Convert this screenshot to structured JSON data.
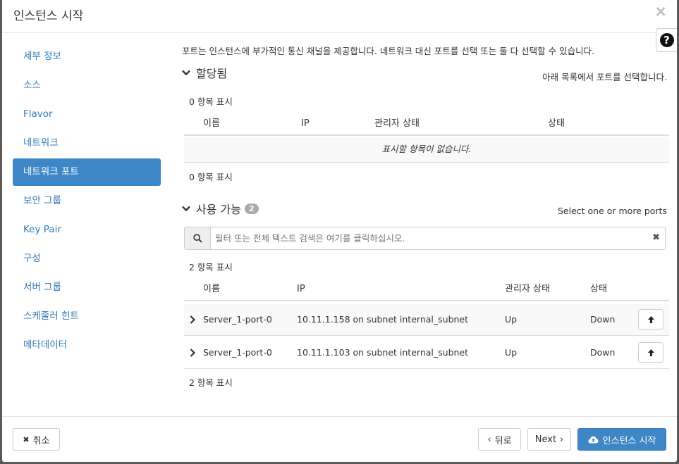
{
  "header": {
    "title": "인스턴스 시작",
    "close_label": "×",
    "help_label": "?"
  },
  "sidebar": {
    "items": [
      {
        "label": "세부 정보",
        "active": false
      },
      {
        "label": "소스",
        "active": false
      },
      {
        "label": "Flavor",
        "active": false
      },
      {
        "label": "네트워크",
        "active": false
      },
      {
        "label": "네트워크 포트",
        "active": true
      },
      {
        "label": "보안 그룹",
        "active": false
      },
      {
        "label": "Key Pair",
        "active": false
      },
      {
        "label": "구성",
        "active": false
      },
      {
        "label": "서버 그룹",
        "active": false
      },
      {
        "label": "스케줄러 힌트",
        "active": false
      },
      {
        "label": "메타데이터",
        "active": false
      }
    ]
  },
  "main": {
    "intro": "포트는 인스턴스에 부가적인 통신 채널을 제공합니다. 네트워크 대신 포트를 선택 또는 둘 다 선택할 수 있습니다.",
    "allocated": {
      "title": "할당됨",
      "help": "아래 목록에서 포트를 선택합니다.",
      "count_top": "0 항목 표시",
      "columns": [
        "이름",
        "IP",
        "관리자 상태",
        "상태"
      ],
      "empty": "표시할 항목이 없습니다.",
      "count_bottom": "0 항목 표시"
    },
    "available": {
      "title": "사용 가능",
      "badge": "2",
      "help": "Select one or more ports",
      "search_placeholder": "필터 또는 전체 텍스트 검색은 여기를 클릭하십시오.",
      "count_top": "2 항목 표시",
      "columns": [
        "이름",
        "IP",
        "관리자 상태",
        "상태"
      ],
      "rows": [
        {
          "name": "Server_1-port-0",
          "ip": "10.11.1.158 on subnet internal_subnet",
          "admin_state": "Up",
          "status": "Down"
        },
        {
          "name": "Server_1-port-0",
          "ip": "10.11.1.103 on subnet internal_subnet",
          "admin_state": "Up",
          "status": "Down"
        }
      ],
      "count_bottom": "2 항목 표시"
    }
  },
  "footer": {
    "cancel_label": "취소",
    "back_label": "뒤로",
    "next_label": "Next",
    "launch_label": "인스턴스 시작"
  },
  "colors": {
    "accent": "#3d87c7",
    "link": "#337ab7"
  }
}
